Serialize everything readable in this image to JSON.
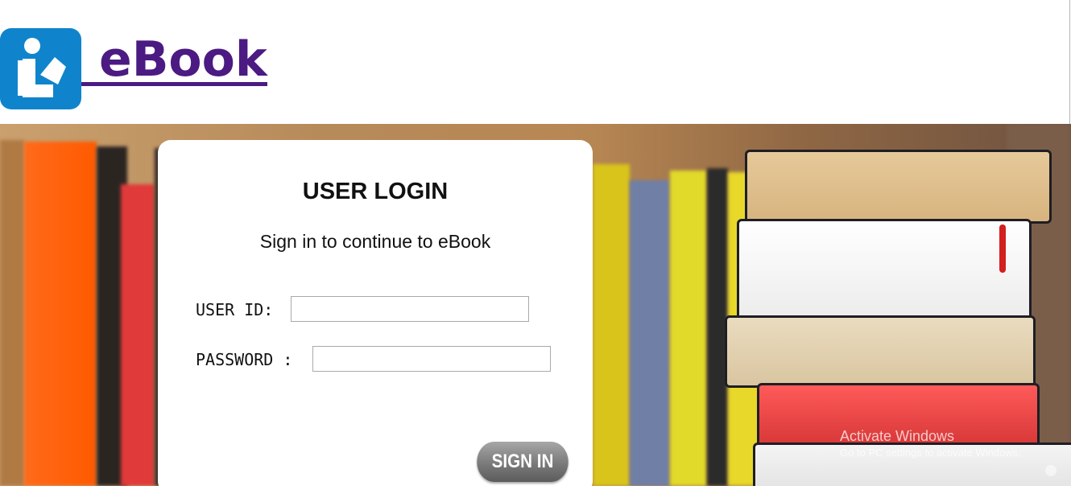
{
  "header": {
    "logo_icon": "reader-book-icon",
    "site_name": "eBook",
    "brand_color": "#4b1a82",
    "icon_color": "#0f84cc"
  },
  "login": {
    "title": "USER LOGIN",
    "subtitle": "Sign in to continue to eBook",
    "user_id_label": "USER ID:",
    "user_id_value": "",
    "password_label": "PASSWORD :",
    "password_value": "",
    "signin_label": "SIGN IN"
  },
  "overlay": {
    "activate_title": "Activate Windows",
    "activate_sub": "Go to PC settings to activate Windows."
  }
}
